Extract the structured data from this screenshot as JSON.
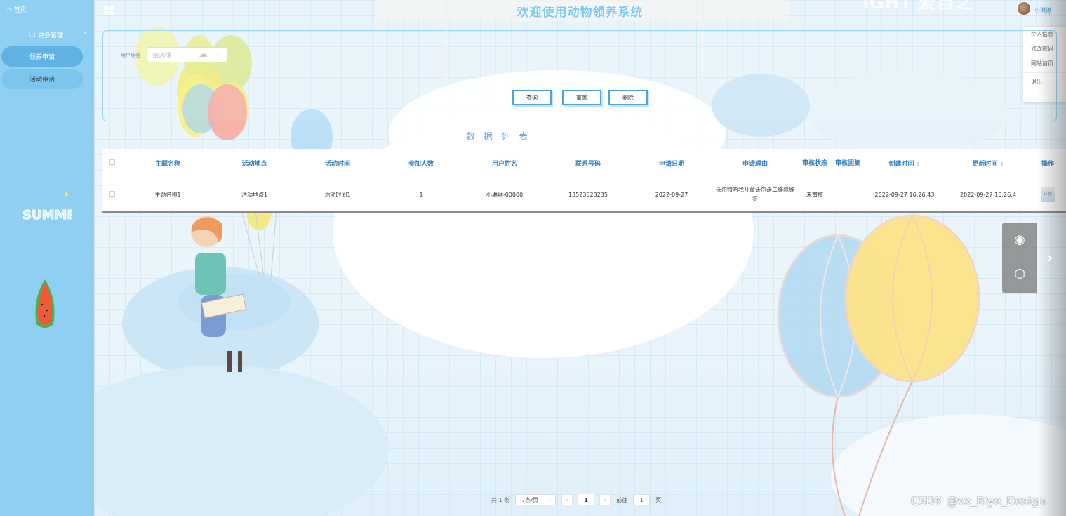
{
  "sidebar": {
    "home_label": "首页",
    "group_label": "更多管理",
    "items": [
      {
        "label": "领养申请"
      },
      {
        "label": "活动申请"
      }
    ]
  },
  "header": {
    "title": "欢迎使用动物领养系统",
    "username": "小琳琳"
  },
  "user_menu": [
    "个人信息",
    "修改密码",
    "网站首页",
    "退出"
  ],
  "search": {
    "field_label": "用户姓名",
    "select_placeholder": "请选择",
    "query_label": "查询",
    "reset_label": "重置",
    "delete_label": "删除"
  },
  "list_title": "数据列表",
  "table": {
    "columns": [
      "主题名称",
      "活动地点",
      "活动时间",
      "参加人数",
      "用户姓名",
      "联系号码",
      "申请日期",
      "申请理由",
      "审核状态",
      "审核回复",
      "创建时间",
      "更新时间",
      "操作"
    ],
    "rows": [
      {
        "theme": "主题名称1",
        "place": "活动地点1",
        "time": "活动时间1",
        "count": "1",
        "user": "小琳琳-00000",
        "phone": "13523523235",
        "date": "2022-09-27",
        "reason": "沃尔特哈我儿童沃尔沃二维尔维尔",
        "status": "未审核",
        "reply": "",
        "created": "2022-09-27 16:26:43",
        "updated": "2022-09-27 16:26:4",
        "op_label": "详情"
      }
    ]
  },
  "pagination": {
    "total": "共 1 条",
    "page_size": "7条/页",
    "current": "1",
    "goto_prefix": "前往",
    "goto_value": "1",
    "goto_suffix": "页"
  },
  "watermark": "CSDN @vx_Biye_Design",
  "colors": {
    "sidebar": "#8fd0f2",
    "accent": "#4aa4e0",
    "header_text": "#2f7fc4"
  }
}
